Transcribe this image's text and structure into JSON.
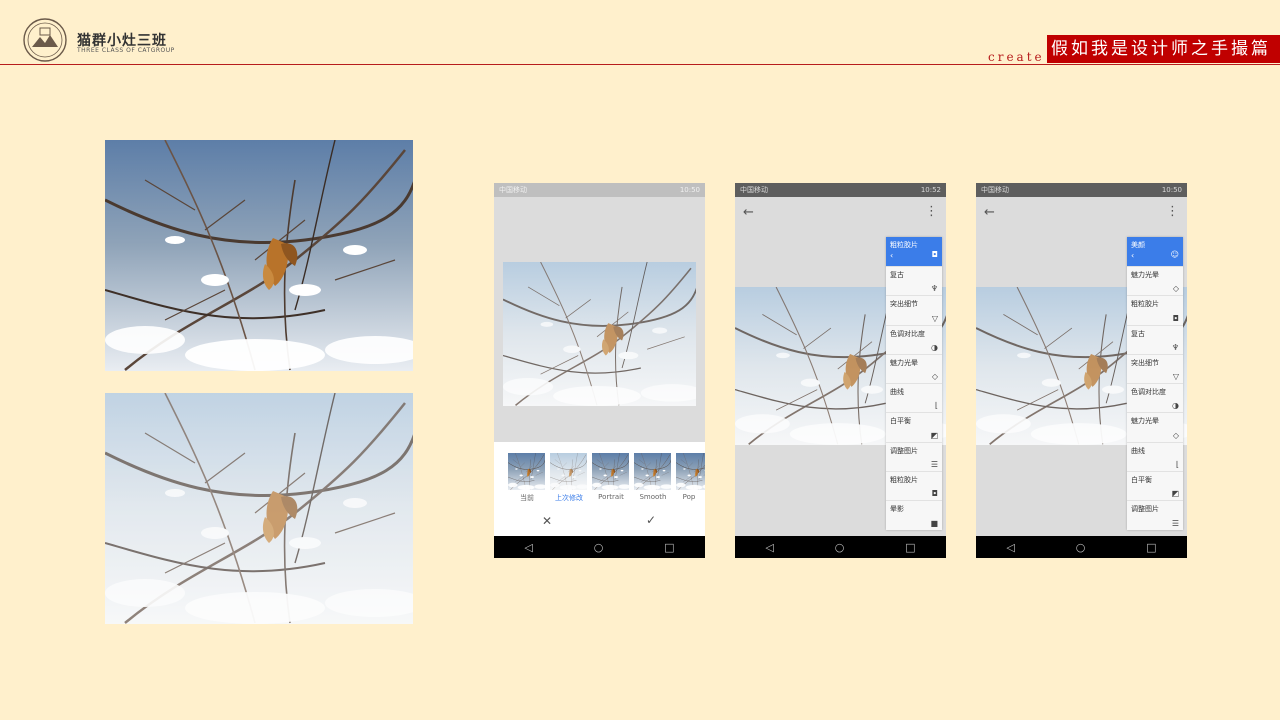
{
  "header": {
    "brand_cn": "猫群小灶三班",
    "brand_en": "THREE CLASS OF CATGROUP",
    "create_label": "create",
    "title": "假如我是设计师之手撮篇"
  },
  "colors": {
    "background": "#fff0cc",
    "accent": "#c00000",
    "menu_blue": "#3b7de9"
  },
  "phones": [
    {
      "status": {
        "carrier": "中国移动",
        "time": "10:50"
      },
      "thumbnails": [
        {
          "label": "当前",
          "active": false
        },
        {
          "label": "上次修改",
          "active": true
        },
        {
          "label": "Portrait",
          "active": false
        },
        {
          "label": "Smooth",
          "active": false
        },
        {
          "label": "Pop",
          "active": false
        }
      ],
      "cancel_icon": "close-icon",
      "confirm_icon": "check-icon"
    },
    {
      "status": {
        "carrier": "中国移动",
        "time": "10:52"
      },
      "menu": {
        "header": "粗粒胶片",
        "items": [
          "复古",
          "突出细节",
          "色调对比度",
          "魅力光晕",
          "曲线",
          "白平衡",
          "调整图片",
          "粗粒胶片",
          "晕影"
        ]
      }
    },
    {
      "status": {
        "carrier": "中国移动",
        "time": "10:50"
      },
      "menu": {
        "header": "美颜",
        "items": [
          "魅力光晕",
          "粗粒胶片",
          "复古",
          "突出细节",
          "色调对比度",
          "魅力光晕",
          "曲线",
          "白平衡",
          "调整图片"
        ]
      }
    }
  ]
}
